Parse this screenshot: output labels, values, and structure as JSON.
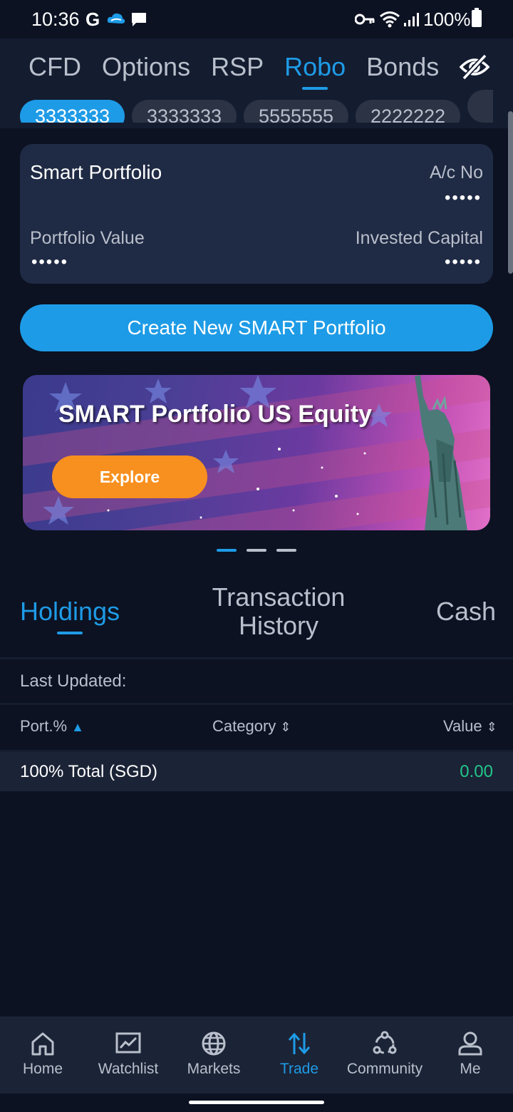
{
  "status_bar": {
    "time": "10:36",
    "google_letter": "G",
    "battery": "100%"
  },
  "top_tabs": [
    {
      "label": "CFD",
      "active": false
    },
    {
      "label": "Options",
      "active": false
    },
    {
      "label": "RSP",
      "active": false
    },
    {
      "label": "Robo",
      "active": true
    },
    {
      "label": "Bonds",
      "active": false
    }
  ],
  "hide_values_icon": "eye-slash-icon",
  "accounts": [
    "3333333",
    "3333333",
    "5555555",
    "2222222",
    ""
  ],
  "portfolio_card": {
    "title": "Smart Portfolio",
    "acno_label": "A/c No",
    "acno_value": "•••••",
    "portfolio_value_label": "Portfolio Value",
    "portfolio_value": "•••••",
    "invested_capital_label": "Invested Capital",
    "invested_capital": "•••••"
  },
  "create_button": "Create New SMART Portfolio",
  "banner": {
    "title": "SMART Portfolio US Equity",
    "button": "Explore"
  },
  "carousel": {
    "count": 3,
    "active_index": 0
  },
  "section_tabs": [
    {
      "label": "Holdings",
      "active": true
    },
    {
      "label": "Transaction History",
      "active": false
    },
    {
      "label": "Cash",
      "active": false
    }
  ],
  "last_updated_label": "Last Updated:",
  "table": {
    "columns": [
      "Port.%",
      "Category",
      "Value"
    ],
    "total_label": "100% Total (SGD)",
    "total_value": "0.00"
  },
  "bottom_nav": [
    {
      "label": "Home",
      "icon": "home-icon",
      "active": false
    },
    {
      "label": "Watchlist",
      "icon": "chart-icon",
      "active": false
    },
    {
      "label": "Markets",
      "icon": "globe-icon",
      "active": false
    },
    {
      "label": "Trade",
      "icon": "arrows-updown-icon",
      "active": true
    },
    {
      "label": "Community",
      "icon": "community-icon",
      "active": false
    },
    {
      "label": "Me",
      "icon": "user-icon",
      "active": false
    }
  ],
  "colors": {
    "accent": "#1e9be6",
    "background": "#0c1222",
    "card": "#1f2a44",
    "positive": "#22c68a",
    "explore": "#f7901e"
  }
}
